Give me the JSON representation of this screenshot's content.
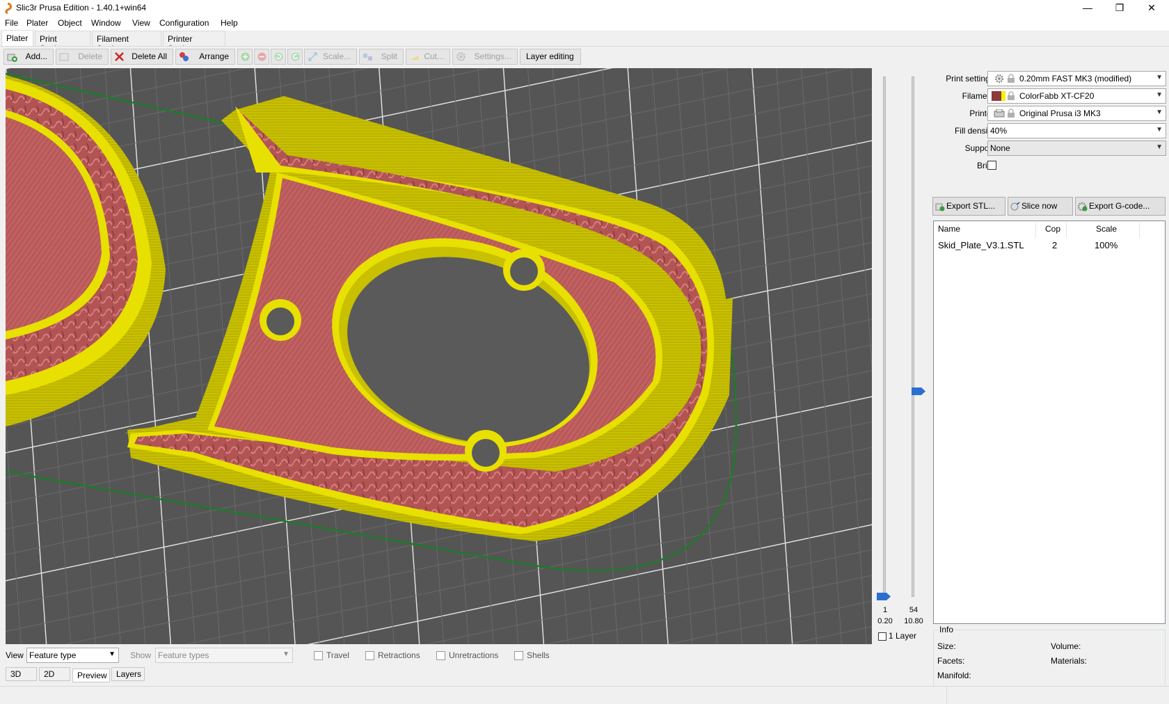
{
  "window": {
    "title": "Slic3r Prusa Edition - 1.40.1+win64",
    "minimize_glyph": "—",
    "maximize_glyph": "❐",
    "close_glyph": "✕"
  },
  "menu": [
    "File",
    "Plater",
    "Object",
    "Window",
    "View",
    "Configuration",
    "Help"
  ],
  "tabs": [
    "Plater",
    "Print Settings",
    "Filament Settings",
    "Printer Settings"
  ],
  "toolbar": {
    "add": "Add...",
    "delete": "Delete",
    "delete_all": "Delete All",
    "arrange": "Arrange",
    "scale": "Scale...",
    "split": "Split",
    "cut": "Cut...",
    "settings": "Settings...",
    "layer_editing": "Layer editing"
  },
  "slider": {
    "bottom_layer": "1",
    "bottom_height": "0.20",
    "top_layer": "54",
    "top_height": "10.80",
    "one_layer_label": "1 Layer"
  },
  "settings": {
    "print_label": "Print settings:",
    "print_value": "0.20mm FAST MK3 (modified)",
    "filament_label": "Filament:",
    "filament_value": "ColorFabb XT-CF20",
    "filament_color": "#8b3a3a",
    "filament_color2": "#ffee00",
    "printer_label": "Printer:",
    "printer_value": "Original Prusa i3 MK3",
    "fill_label": "Fill density:",
    "fill_value": "40%",
    "support_label": "Support:",
    "support_value": "None",
    "brim_label": "Brim:"
  },
  "actions": {
    "export_stl": "Export STL...",
    "slice_now": "Slice now",
    "export_gcode": "Export G-code..."
  },
  "object_list": {
    "headers": [
      "Name",
      "Cop",
      "Scale"
    ],
    "rows": [
      {
        "name": "Skid_Plate_V3.1.STL",
        "copies": "2",
        "scale": "100%"
      }
    ]
  },
  "info": {
    "title": "Info",
    "size": "Size:",
    "volume": "Volume:",
    "facets": "Facets:",
    "materials": "Materials:",
    "manifold": "Manifold:"
  },
  "bottom": {
    "view_label": "View",
    "view_value": "Feature type",
    "show_label": "Show",
    "show_value": "Feature types",
    "travel": "Travel",
    "retractions": "Retractions",
    "unretractions": "Unretractions",
    "shells": "Shells"
  },
  "bottom_tabs": [
    "3D",
    "2D",
    "Preview",
    "Layers"
  ],
  "colors": {
    "perimeter": "#e8e000",
    "infill": "#b85a5a",
    "skirt": "#1f7a2a",
    "bed": "#5a5a5a",
    "accent": "#2a6fd0"
  }
}
